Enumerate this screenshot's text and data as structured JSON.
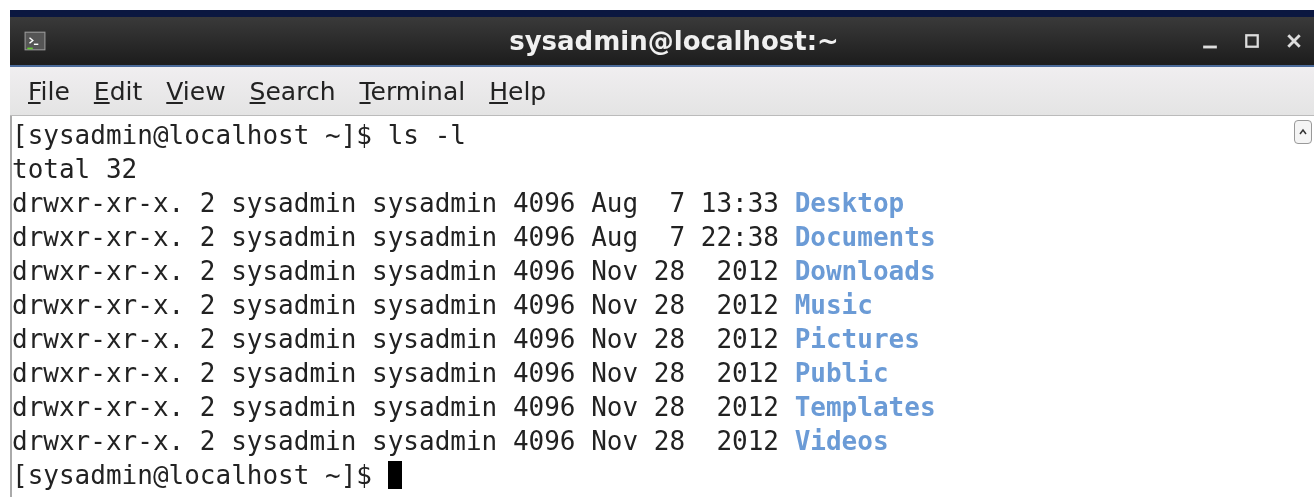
{
  "window": {
    "title": "sysadmin@localhost:~"
  },
  "menu": [
    "File",
    "Edit",
    "View",
    "Search",
    "Terminal",
    "Help"
  ],
  "terminal": {
    "lines": [
      {
        "kind": "prompt",
        "prompt": "[sysadmin@localhost ~]$",
        "command": "ls -l"
      },
      {
        "kind": "output",
        "text": "total 32"
      },
      {
        "kind": "entry",
        "info": "drwxr-xr-x. 2 sysadmin sysadmin 4096 Aug  7 13:33",
        "name": "Desktop"
      },
      {
        "kind": "entry",
        "info": "drwxr-xr-x. 2 sysadmin sysadmin 4096 Aug  7 22:38",
        "name": "Documents"
      },
      {
        "kind": "entry",
        "info": "drwxr-xr-x. 2 sysadmin sysadmin 4096 Nov 28  2012",
        "name": "Downloads"
      },
      {
        "kind": "entry",
        "info": "drwxr-xr-x. 2 sysadmin sysadmin 4096 Nov 28  2012",
        "name": "Music"
      },
      {
        "kind": "entry",
        "info": "drwxr-xr-x. 2 sysadmin sysadmin 4096 Nov 28  2012",
        "name": "Pictures"
      },
      {
        "kind": "entry",
        "info": "drwxr-xr-x. 2 sysadmin sysadmin 4096 Nov 28  2012",
        "name": "Public"
      },
      {
        "kind": "entry",
        "info": "drwxr-xr-x. 2 sysadmin sysadmin 4096 Nov 28  2012",
        "name": "Templates"
      },
      {
        "kind": "entry",
        "info": "drwxr-xr-x. 2 sysadmin sysadmin 4096 Nov 28  2012",
        "name": "Videos"
      },
      {
        "kind": "prompt",
        "prompt": "[sysadmin@localhost ~]$",
        "cursor": true
      }
    ]
  }
}
